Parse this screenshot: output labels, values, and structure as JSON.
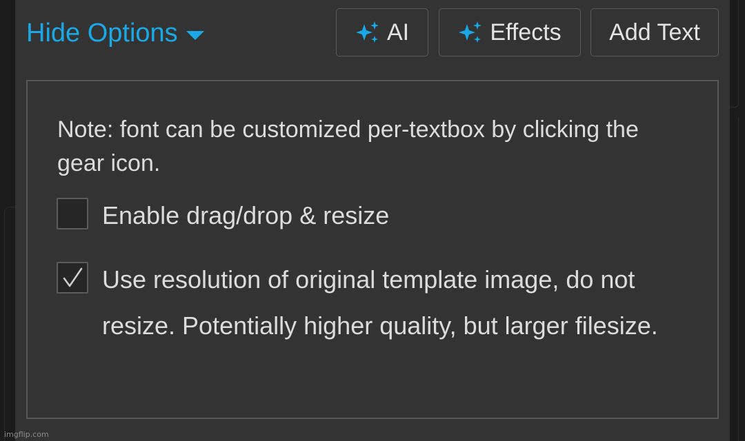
{
  "header": {
    "toggle_label": "Hide Options",
    "buttons": {
      "ai": "AI",
      "effects": "Effects",
      "add_text": "Add Text"
    }
  },
  "options": {
    "note": "Note: font can be customized per-textbox by clicking the gear icon.",
    "items": [
      {
        "label": "Enable drag/drop & resize",
        "checked": false
      },
      {
        "label": "Use resolution of original template image, do not resize. Potentially higher quality, but larger filesize.",
        "checked": true
      }
    ]
  },
  "watermark": "imgflip.com",
  "colors": {
    "accent": "#1aa9e6",
    "panel_bg": "#333333",
    "text": "#dcdcdc",
    "border": "#595959"
  },
  "icons": {
    "toggle": "caret-down-icon",
    "ai": "sparkles-icon",
    "effects": "sparkles-icon",
    "checked": "checkmark-icon"
  }
}
